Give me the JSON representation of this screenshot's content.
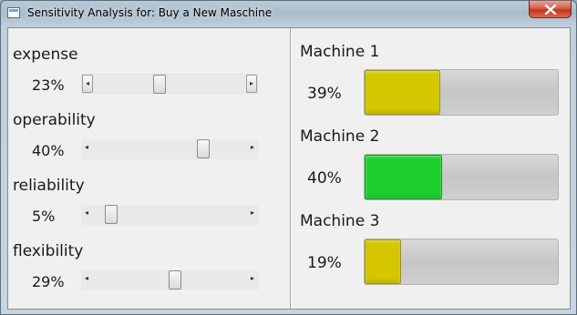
{
  "window": {
    "title": "Sensitivity Analysis for: Buy a New Maschine",
    "close_icon": "close-icon"
  },
  "criteria": [
    {
      "name": "expense",
      "percent_label": "23%",
      "value": 0.23,
      "arrows_boxed": true
    },
    {
      "name": "operability",
      "percent_label": "40%",
      "value": 0.4,
      "arrows_boxed": false
    },
    {
      "name": "reliability",
      "percent_label": "5%",
      "value": 0.05,
      "arrows_boxed": false
    },
    {
      "name": "flexibility",
      "percent_label": "29%",
      "value": 0.29,
      "arrows_boxed": false
    }
  ],
  "machines": [
    {
      "name": "Machine 1",
      "percent_label": "39%",
      "value": 0.39,
      "color": "#d4c800"
    },
    {
      "name": "Machine 2",
      "percent_label": "40%",
      "value": 0.4,
      "color": "#1ccf2e"
    },
    {
      "name": "Machine 3",
      "percent_label": "19%",
      "value": 0.19,
      "color": "#d6c600"
    }
  ]
}
